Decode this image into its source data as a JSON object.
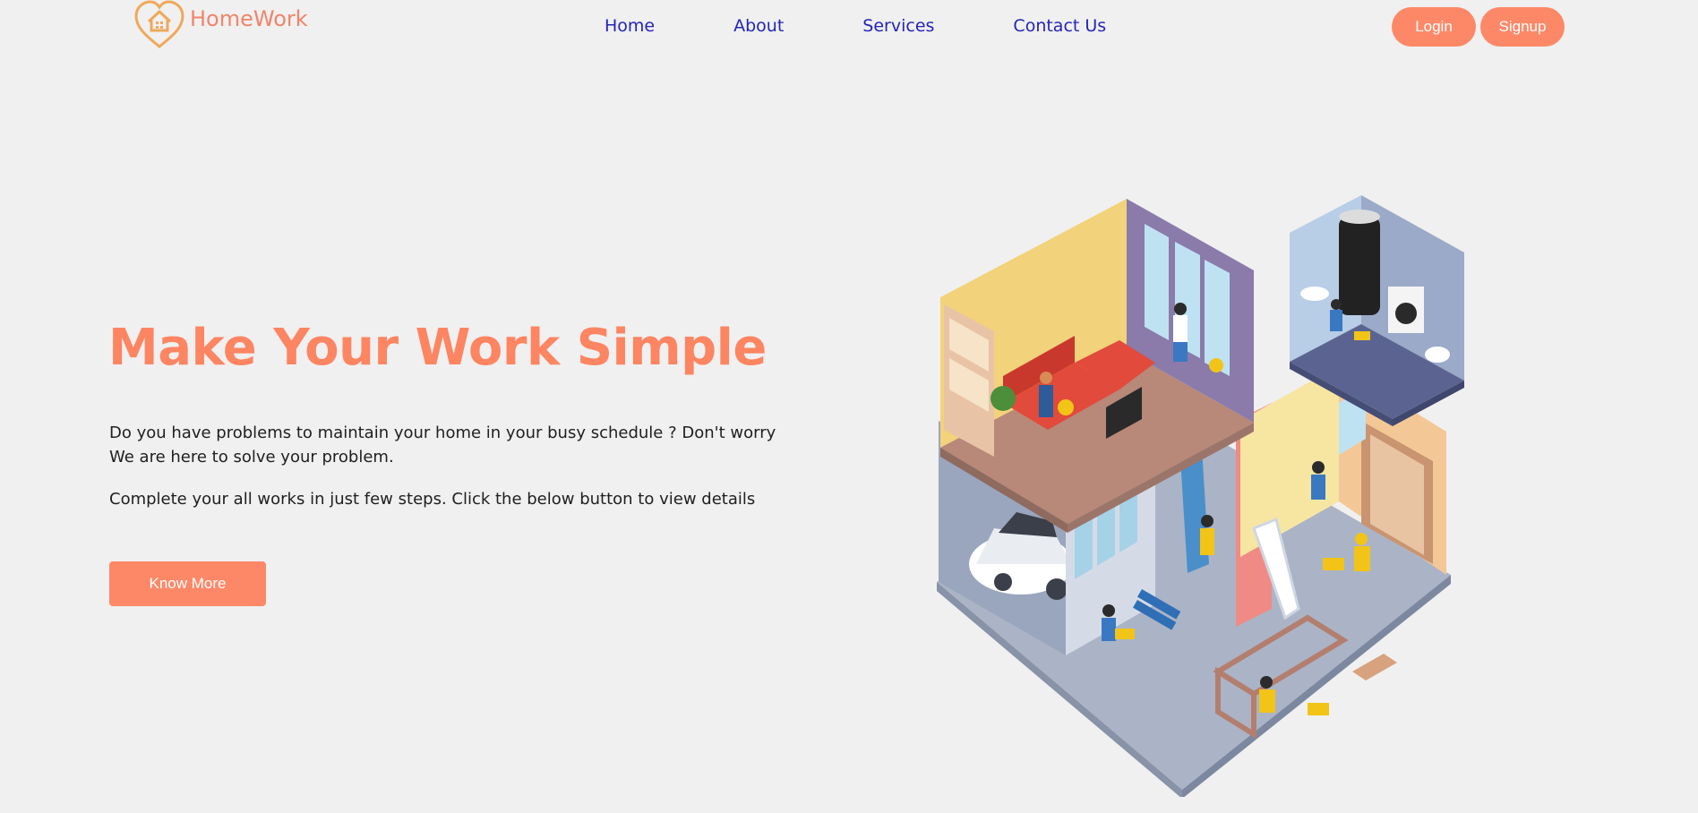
{
  "header": {
    "logo_text": "HomeWork",
    "logo_icon": "house-heart-icon",
    "nav": {
      "home": "Home",
      "about": "About",
      "services": "Services",
      "contact": "Contact Us"
    },
    "login_label": "Login",
    "signup_label": "Signup"
  },
  "hero": {
    "title": "Make Your Work Simple",
    "paragraph1_line1": "Do you have problems to maintain your home in your busy schedule ? Don't worry",
    "paragraph1_line2": "We are here to solve your problem.",
    "paragraph2": "Complete your all works in just few steps. Click the below button to view details",
    "button_label": "Know More",
    "illustration": "isometric-house-cleaning-repair-illustration"
  },
  "colors": {
    "accent": "#fd8868",
    "title": "#fd8562",
    "nav_link": "#2424b8",
    "logo": "#f0856a",
    "logo_icon": "#f0a85a",
    "background": "#f0f0f0"
  }
}
